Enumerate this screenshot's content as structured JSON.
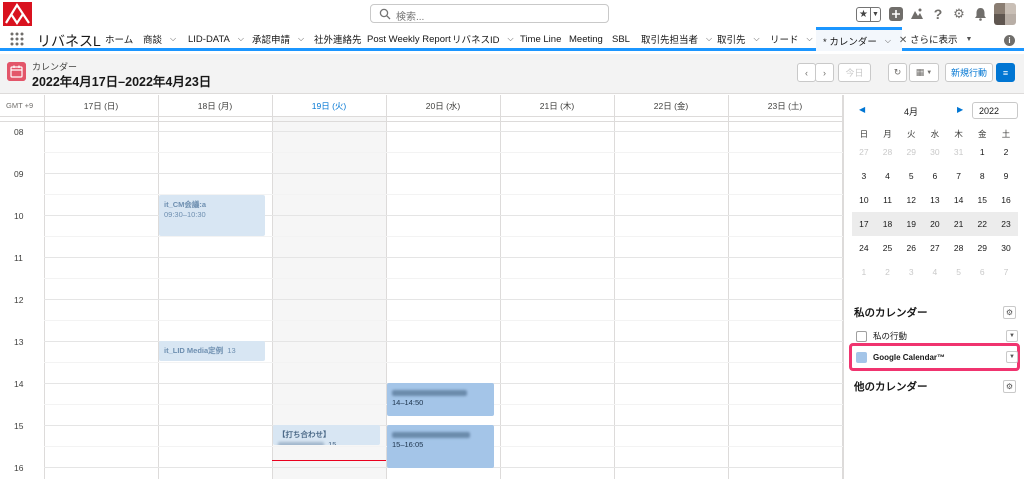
{
  "search": {
    "placeholder": "検索..."
  },
  "nav": {
    "app_name": "リバネスL",
    "items": [
      {
        "label": "ホーム",
        "chevron": false
      },
      {
        "label": "商談",
        "chevron": true
      },
      {
        "label": "LID-DATA",
        "chevron": true
      },
      {
        "label": "承認申請",
        "chevron": true
      },
      {
        "label": "社外連絡先",
        "chevron": false
      },
      {
        "label": "Post Weekly Report",
        "chevron": false
      },
      {
        "label": "リバネスID",
        "chevron": true
      },
      {
        "label": "Time Line",
        "chevron": false
      },
      {
        "label": "Meeting",
        "chevron": false
      },
      {
        "label": "SBL",
        "chevron": false
      },
      {
        "label": "取引先担当者",
        "chevron": true
      },
      {
        "label": "取引先",
        "chevron": true
      },
      {
        "label": "リード",
        "chevron": true
      },
      {
        "label": "* カレンダー",
        "chevron": true,
        "active": true
      },
      {
        "label": "さらに表示",
        "chevron": true
      }
    ]
  },
  "page": {
    "crumb": "カレンダー",
    "date_range": "2022年4月17日–2022年4月23日",
    "today_btn": "今日",
    "new_event_btn": "新規行動"
  },
  "grid": {
    "gmt": "GMT +9",
    "days": [
      "17日 (日)",
      "18日 (月)",
      "19日 (火)",
      "20日 (水)",
      "21日 (木)",
      "22日 (金)",
      "23日 (土)"
    ],
    "today_index": 2,
    "hours": [
      "08",
      "09",
      "10",
      "11",
      "12",
      "13",
      "14",
      "15",
      "16"
    ]
  },
  "events": [
    {
      "id": "e1",
      "title": "it_CM会議:a",
      "time": "09:30–10:30",
      "style": "light"
    },
    {
      "id": "e2",
      "title": "it_LID Media定例",
      "suffix": "13",
      "style": "light"
    },
    {
      "id": "e3",
      "title": "",
      "time": "14–14:50",
      "style": "dark"
    },
    {
      "id": "e4",
      "title": "【打ち合わせ】",
      "suffix": "15",
      "style": "light"
    },
    {
      "id": "e5",
      "title": "",
      "time": "15–16:05",
      "style": "dark"
    }
  ],
  "mini_cal": {
    "month": "4月",
    "year": "2022",
    "weekdays": [
      "日",
      "月",
      "火",
      "水",
      "木",
      "金",
      "土"
    ],
    "weeks": [
      [
        "27",
        "28",
        "29",
        "30",
        "31",
        "1",
        "2"
      ],
      [
        "3",
        "4",
        "5",
        "6",
        "7",
        "8",
        "9"
      ],
      [
        "10",
        "11",
        "12",
        "13",
        "14",
        "15",
        "16"
      ],
      [
        "17",
        "18",
        "19",
        "20",
        "21",
        "22",
        "23"
      ],
      [
        "24",
        "25",
        "26",
        "27",
        "28",
        "29",
        "30"
      ],
      [
        "1",
        "2",
        "3",
        "4",
        "5",
        "6",
        "7"
      ]
    ],
    "selected_week": 3
  },
  "my_calendars": {
    "title": "私のカレンダー",
    "items": [
      {
        "label": "私の行動",
        "checked": false
      },
      {
        "label": "Google Calendar™",
        "checked": true
      }
    ]
  },
  "other_calendars": {
    "title": "他のカレンダー"
  },
  "colors": {
    "accent": "#0176d3",
    "event_light": "#d8e6f3",
    "event_dark": "#a4c5e8",
    "highlight": "#f0346f",
    "calendar_icon": "#e3566a"
  }
}
